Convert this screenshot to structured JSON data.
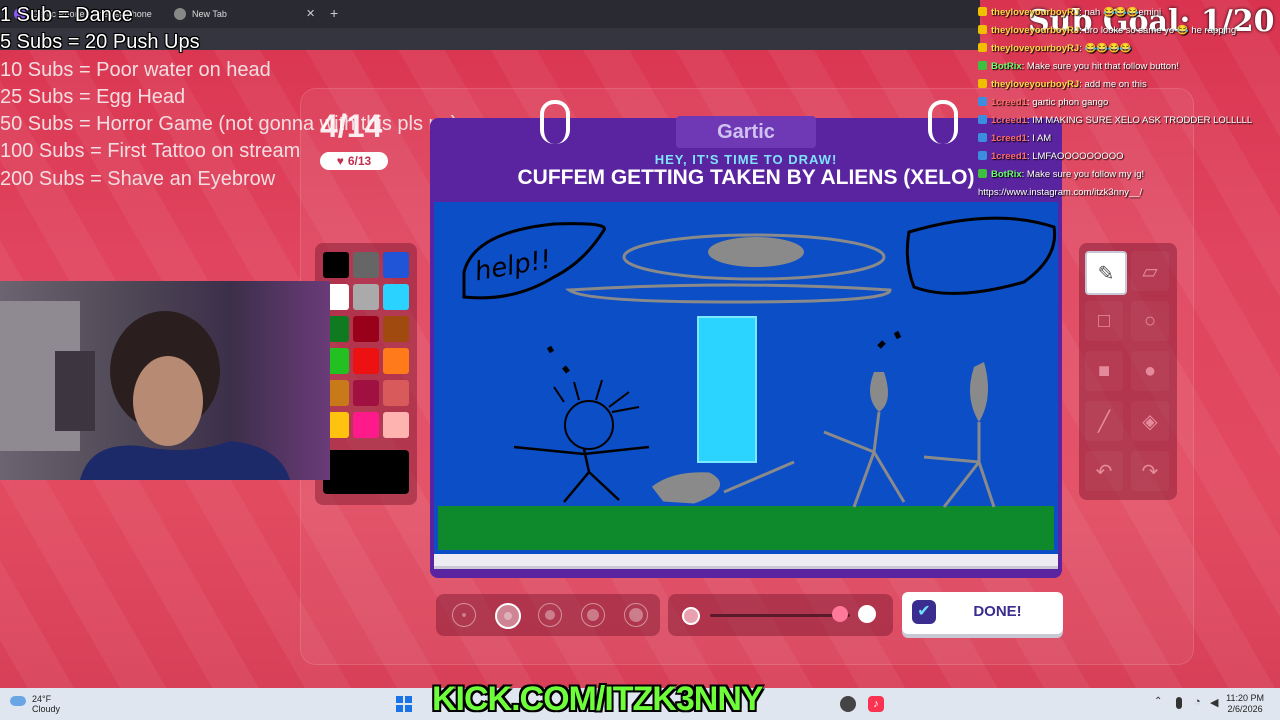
{
  "browser": {
    "tabs": [
      {
        "label": "Gartic Phone - The Telephone Game"
      },
      {
        "label": "New Tab"
      }
    ],
    "new_tab_symbol": "+"
  },
  "sub_goals": [
    "1 Sub = Dance",
    "5 Subs = 20 Push Ups",
    "10 Subs =  Poor water on head",
    "25 Subs = Egg Head",
    "50 Subs =  Horror Game (not gonna with this pls no)",
    "100 Subs = First Tattoo on stream",
    "200 Subs =  Shave an Eyebrow"
  ],
  "game": {
    "round": "4/14",
    "players": "6/13",
    "logo": "Gartic",
    "header": "HEY, IT'S TIME TO DRAW!",
    "prompt": "CUFFEM GETTING TAKEN BY ALIENS (XELO)",
    "canvas_text": "help!!",
    "done_label": "DONE!",
    "palette_colors": [
      "#000000",
      "#666666",
      "#1f55d6",
      "#ffffff",
      "#aaaaaa",
      "#2ad3ff",
      "#107a20",
      "#99001a",
      "#a04a10",
      "#22c020",
      "#ee1111",
      "#ff7a1a",
      "#c87a1a",
      "#a01040",
      "#d85a5a",
      "#ffc20e",
      "#ff1a8c",
      "#ffb3b0"
    ],
    "current_color": "#000000",
    "tools": [
      "pencil-icon",
      "eraser-icon",
      "rect-outline-icon",
      "circle-outline-icon",
      "rect-filled-icon",
      "circle-filled-icon",
      "line-icon",
      "fill-bucket-icon",
      "undo-icon",
      "redo-icon"
    ],
    "brush_sizes": 5,
    "selected_brush": 2
  },
  "chat": {
    "sub_goal": "Sub Goal: 1/20",
    "messages": [
      {
        "user": "theyloveyourboyRJ",
        "user_color": "#ffd84a",
        "text": ": nah 😂😂😂emini"
      },
      {
        "user": "theyloveyourboyRJ",
        "user_color": "#ffd84a",
        "text": ": bro looks so same yo 😂 he rapping"
      },
      {
        "user": "theyloveyourboyRJ",
        "user_color": "#ffd84a",
        "text": ": 😂😂😂😂"
      },
      {
        "user": "BotRix",
        "user_color": "#6cff6c",
        "text": ": Make sure you hit that follow button!"
      },
      {
        "user": "theyloveyourboyRJ",
        "user_color": "#ffd84a",
        "text": ": add me on this"
      },
      {
        "user": "1creed1",
        "user_color": "#ff6b6b",
        "text": ": gartic phon gango"
      },
      {
        "user": "1creed1",
        "user_color": "#ff6b6b",
        "text": ": IM MAKING SURE XELO ASK TRODDER LOLLLLL"
      },
      {
        "user": "1creed1",
        "user_color": "#ff6b6b",
        "text": ": I AM"
      },
      {
        "user": "1creed1",
        "user_color": "#ff6b6b",
        "text": ": LMFAOOOOOOOOO"
      },
      {
        "user": "BotRix",
        "user_color": "#6cff6c",
        "text": ": Make sure you follow my ig!"
      },
      {
        "user": "",
        "user_color": "#ffffff",
        "text": "https://www.instagram.com/itzk3nny__/"
      }
    ]
  },
  "taskbar": {
    "temperature": "24°F",
    "condition": "Cloudy",
    "time": "11:20 PM",
    "date": "2/6/2026"
  },
  "kick_overlay": "KICK.COM/ITZK3NNY"
}
